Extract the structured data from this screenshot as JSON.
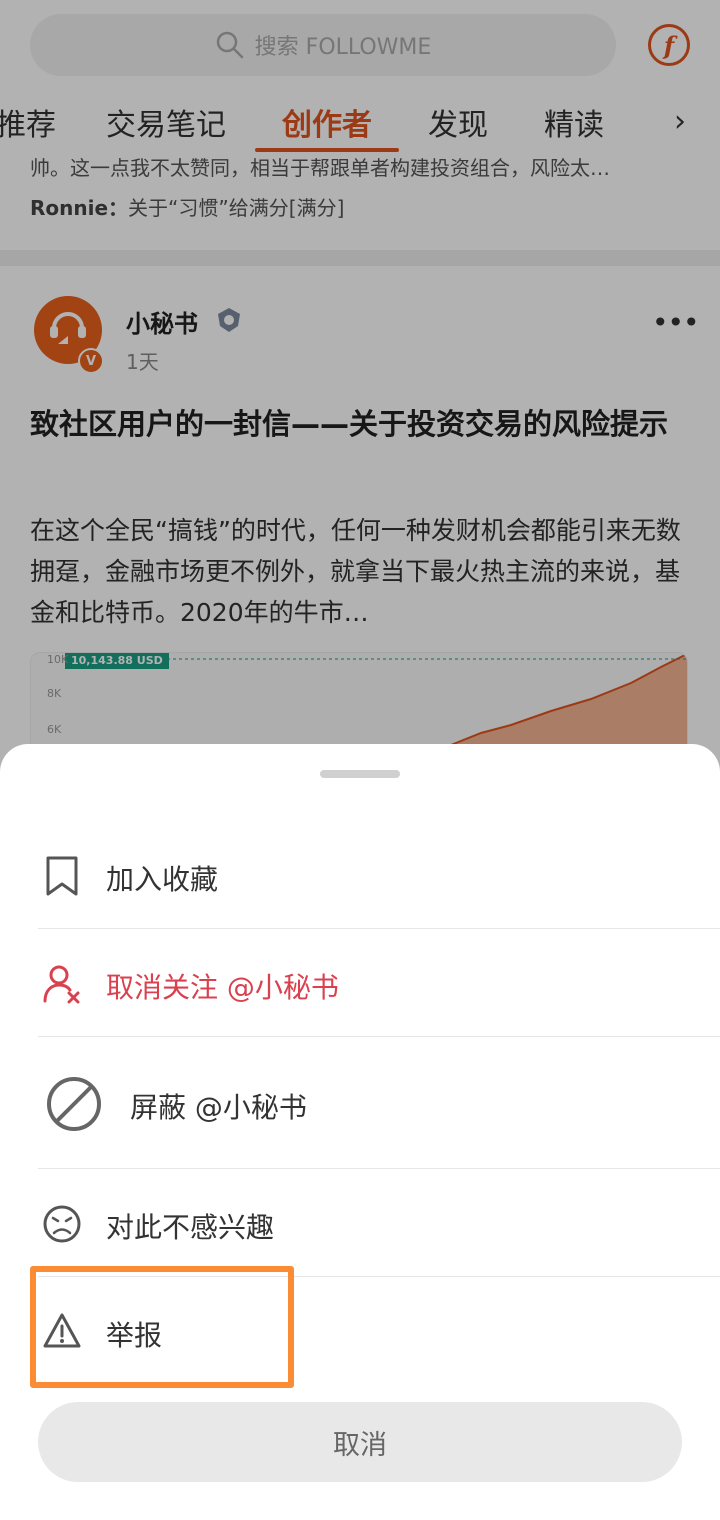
{
  "search": {
    "placeholder": "搜索 FOLLOWME"
  },
  "brand": {
    "logo_glyph": "f",
    "color": "#e0531f"
  },
  "tabs": [
    {
      "label": "推荐"
    },
    {
      "label": "交易笔记"
    },
    {
      "label": "创作者",
      "active": true
    },
    {
      "label": "发现"
    },
    {
      "label": "精读"
    }
  ],
  "tabs_more_glyph": "›",
  "previous_post": {
    "snippet": "帅。这一点我不太赞同，相当于帮跟单者构建投资组合，风险太…",
    "comment_author": "Ronnie：",
    "comment_text": "关于“习惯”给满分[满分]"
  },
  "post": {
    "author": "小秘书",
    "verified_glyph": "V",
    "time": "1天",
    "more_glyph": "•••",
    "title": "致社区用户的一封信——关于投资交易的风险提示",
    "body": "在这个全民“搞钱”的时代，任何一种发财机会都能引来无数拥趸，金融市场更不例外，就拿当下最火热主流的来说，基金和比特币。2020年的牛市…",
    "chart_tag": "10,143.88 USD",
    "chart_ticks": [
      "10K",
      "8K",
      "6K"
    ]
  },
  "sheet": {
    "items": [
      {
        "label": "加入收藏",
        "icon": "bookmark-icon",
        "color": "#333333"
      },
      {
        "label": "取消关注 @小秘书",
        "icon": "unfollow-user-icon",
        "color": "#d9414f"
      },
      {
        "label": "屏蔽 @小秘书",
        "icon": "block-icon",
        "color": "#333333"
      },
      {
        "label": "对此不感兴趣",
        "icon": "sad-face-icon",
        "color": "#333333"
      },
      {
        "label": "举报",
        "icon": "warning-icon",
        "color": "#333333"
      }
    ],
    "cancel_label": "取消",
    "highlight_color": "#fb8c34"
  }
}
